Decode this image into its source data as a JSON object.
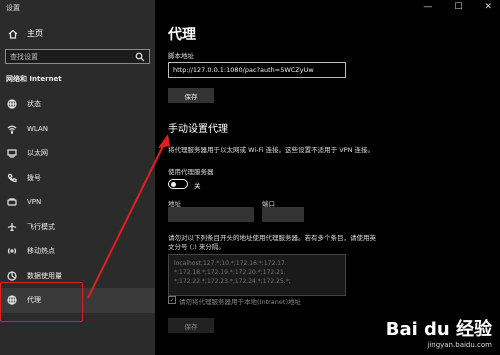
{
  "window": {
    "title": "设置",
    "controls": [
      "—",
      "☐",
      "✕"
    ]
  },
  "sidebar": {
    "home_label": "主页",
    "search_placeholder": "查找设置",
    "section": "网络和 Internet",
    "items": [
      {
        "label": "状态",
        "icon": "globe-status-icon"
      },
      {
        "label": "WLAN",
        "icon": "wifi-icon"
      },
      {
        "label": "以太网",
        "icon": "ethernet-icon"
      },
      {
        "label": "拨号",
        "icon": "phone-icon"
      },
      {
        "label": "VPN",
        "icon": "vpn-icon"
      },
      {
        "label": "飞行模式",
        "icon": "airplane-icon"
      },
      {
        "label": "移动热点",
        "icon": "hotspot-icon"
      },
      {
        "label": "数据使用量",
        "icon": "data-usage-icon"
      },
      {
        "label": "代理",
        "icon": "globe-icon"
      }
    ]
  },
  "main": {
    "title": "代理",
    "script_label": "脚本地址",
    "script_url": "http://127.0.0.1:1080/pac?auth=5WCZyUw",
    "save_label": "保存",
    "manual_title": "手动设置代理",
    "manual_desc": "将代理服务器用于以太网或 Wi-Fi 连接。这些设置不适用于 VPN 连接。",
    "use_proxy_label": "使用代理服务器",
    "toggle_state": "关",
    "address_label": "地址",
    "port_label": "端口",
    "exceptions_desc_1": "请勿对以下列条目开头的地址使用代理服务器。若有多个条目，请使用英",
    "exceptions_desc_2": "文分号 (;) 来分隔。",
    "exceptions_line_1": "localhost;127.*;10.*;172.16.*;172.17.",
    "exceptions_line_2": "*;172.18.*;172.19.*;172.20.*;172.21.",
    "exceptions_line_3": "*;172.22.*;172.23.*;172.24.*;172.25.*;",
    "local_bypass_label": "请勿将代理服务器用于本地(Intranet)地址",
    "save2_label": "保存"
  },
  "watermark": {
    "logo": "Bai du 经验",
    "sub": "jingyan.baidu.com"
  },
  "colors": {
    "annotation": "#e02020",
    "sidebar_bg": "#2b2b2b",
    "content_bg": "#000000"
  }
}
